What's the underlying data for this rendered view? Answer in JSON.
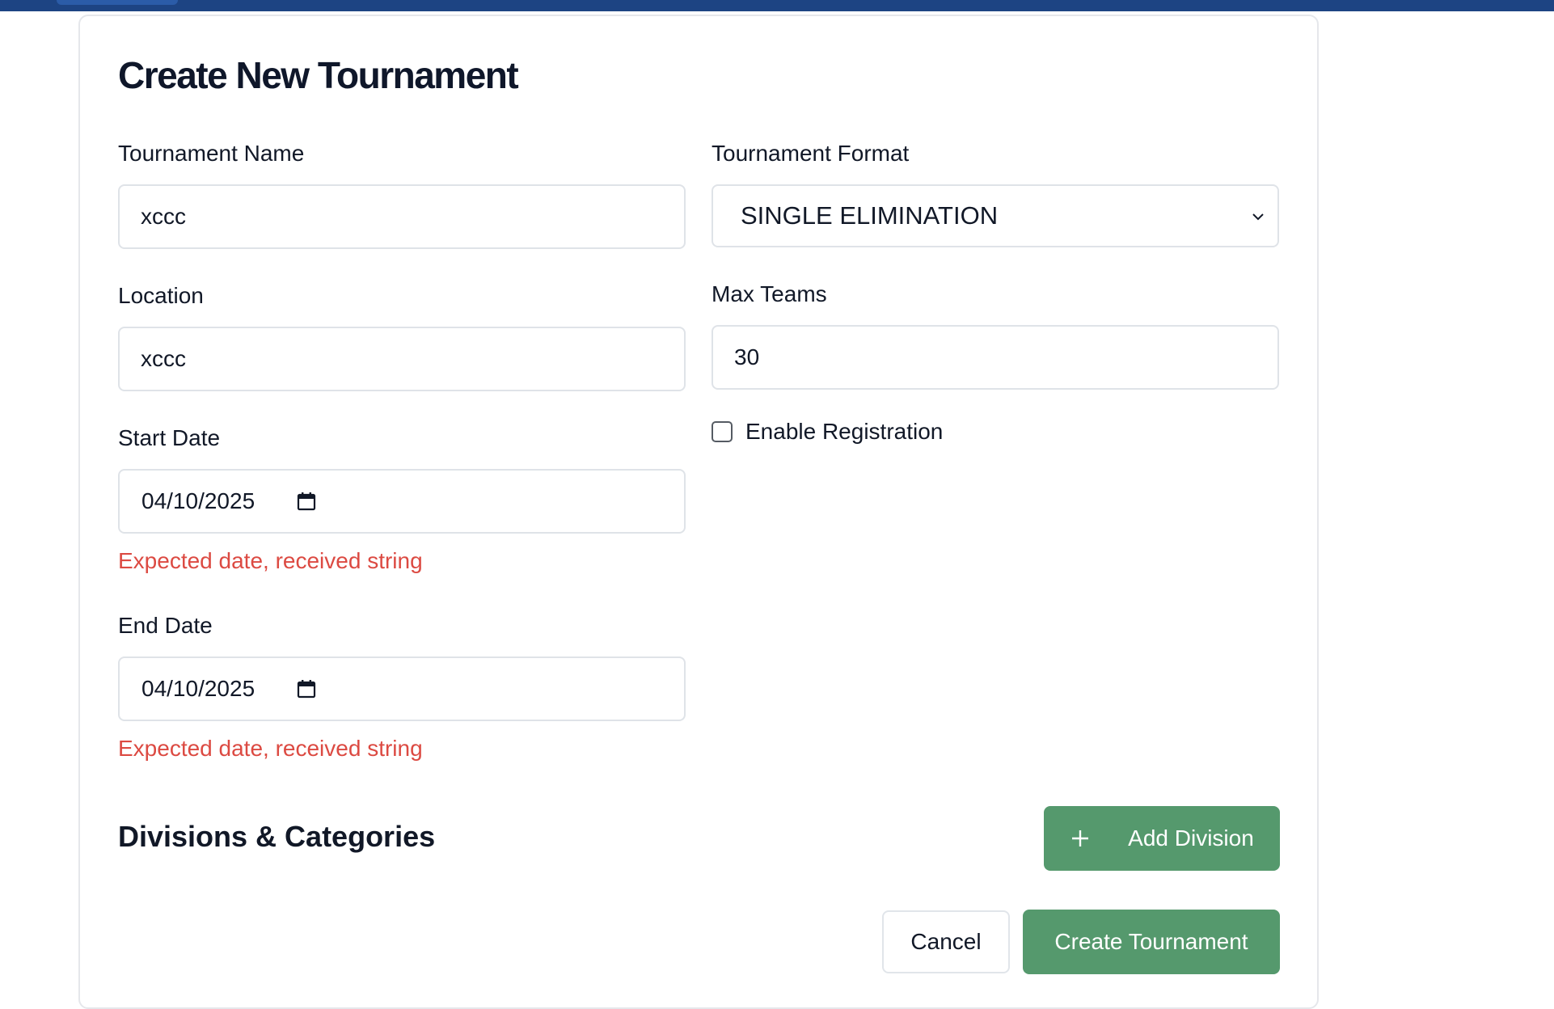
{
  "header": {
    "bar_color": "#1d4483"
  },
  "form": {
    "title": "Create New Tournament",
    "tournament_name": {
      "label": "Tournament Name",
      "value": "xccc"
    },
    "tournament_format": {
      "label": "Tournament Format",
      "selected": "SINGLE ELIMINATION"
    },
    "location": {
      "label": "Location",
      "value": "xccc"
    },
    "max_teams": {
      "label": "Max Teams",
      "value": "30"
    },
    "enable_registration": {
      "label": "Enable Registration",
      "checked": false
    },
    "start_date": {
      "label": "Start Date",
      "value": "04/10/2025",
      "error": "Expected date, received string"
    },
    "end_date": {
      "label": "End Date",
      "value": "04/10/2025",
      "error": "Expected date, received string"
    },
    "divisions": {
      "title": "Divisions & Categories",
      "add_label": "Add Division"
    },
    "actions": {
      "cancel_label": "Cancel",
      "create_label": "Create Tournament"
    }
  },
  "colors": {
    "accent_green": "#55996d",
    "error_red": "#dc4a42",
    "border": "#dfe3e8"
  }
}
